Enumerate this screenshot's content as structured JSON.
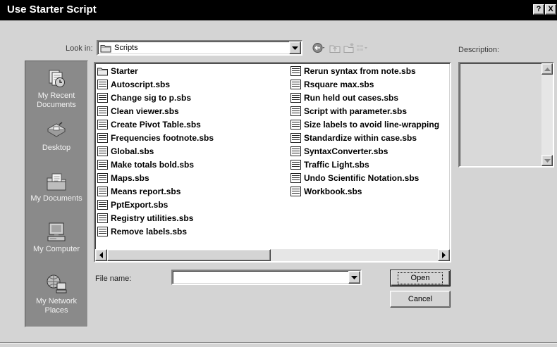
{
  "window": {
    "title": "Use Starter Script",
    "help_button": "?",
    "close_button": "X"
  },
  "look_in": {
    "label": "Look in:",
    "value": "Scripts",
    "icon": "folder-icon"
  },
  "toolbar": {
    "back": "back-icon",
    "up_one_level": "up-one-level-icon",
    "new_folder": "new-folder-icon",
    "views": "view-menu-icon"
  },
  "description": {
    "label": "Description:"
  },
  "places": [
    {
      "label": "My Recent Documents",
      "icon": "recent-documents-icon"
    },
    {
      "label": "Desktop",
      "icon": "desktop-icon"
    },
    {
      "label": "My Documents",
      "icon": "my-documents-icon"
    },
    {
      "label": "My Computer",
      "icon": "my-computer-icon"
    },
    {
      "label": "My Network Places",
      "icon": "network-places-icon"
    }
  ],
  "files": {
    "items": [
      {
        "name": "Starter",
        "icon": "folder-icon"
      },
      {
        "name": "Autoscript.sbs",
        "icon": "script-file-icon"
      },
      {
        "name": "Change sig to p.sbs",
        "icon": "script-file-icon"
      },
      {
        "name": "Clean viewer.sbs",
        "icon": "script-file-icon"
      },
      {
        "name": "Create Pivot Table.sbs",
        "icon": "script-file-icon"
      },
      {
        "name": "Frequencies footnote.sbs",
        "icon": "script-file-icon"
      },
      {
        "name": "Global.sbs",
        "icon": "script-file-icon"
      },
      {
        "name": "Make totals bold.sbs",
        "icon": "script-file-icon"
      },
      {
        "name": "Maps.sbs",
        "icon": "script-file-icon"
      },
      {
        "name": "Means report.sbs",
        "icon": "script-file-icon"
      },
      {
        "name": "PptExport.sbs",
        "icon": "script-file-icon"
      },
      {
        "name": "Registry utilities.sbs",
        "icon": "script-file-icon"
      },
      {
        "name": "Remove labels.sbs",
        "icon": "script-file-icon"
      },
      {
        "name": "Rerun syntax from note.sbs",
        "icon": "script-file-icon"
      },
      {
        "name": "Rsquare max.sbs",
        "icon": "script-file-icon"
      },
      {
        "name": "Run held out cases.sbs",
        "icon": "script-file-icon"
      },
      {
        "name": "Script with parameter.sbs",
        "icon": "script-file-icon"
      },
      {
        "name": "Size labels to avoid line-wrapping",
        "icon": "script-file-icon"
      },
      {
        "name": "Standardize within case.sbs",
        "icon": "script-file-icon"
      },
      {
        "name": "SyntaxConverter.sbs",
        "icon": "script-file-icon"
      },
      {
        "name": "Traffic Light.sbs",
        "icon": "script-file-icon"
      },
      {
        "name": "Undo Scientific Notation.sbs",
        "icon": "script-file-icon"
      },
      {
        "name": "Workbook.sbs",
        "icon": "script-file-icon"
      }
    ]
  },
  "file_name": {
    "label": "File name:",
    "value": ""
  },
  "buttons": {
    "open": "Open",
    "cancel": "Cancel"
  },
  "colors": {
    "title_bar": "#000000",
    "dialog_background": "#d4d4d4",
    "places_bar": "#8a8a8a",
    "list_background": "#ffffff"
  }
}
